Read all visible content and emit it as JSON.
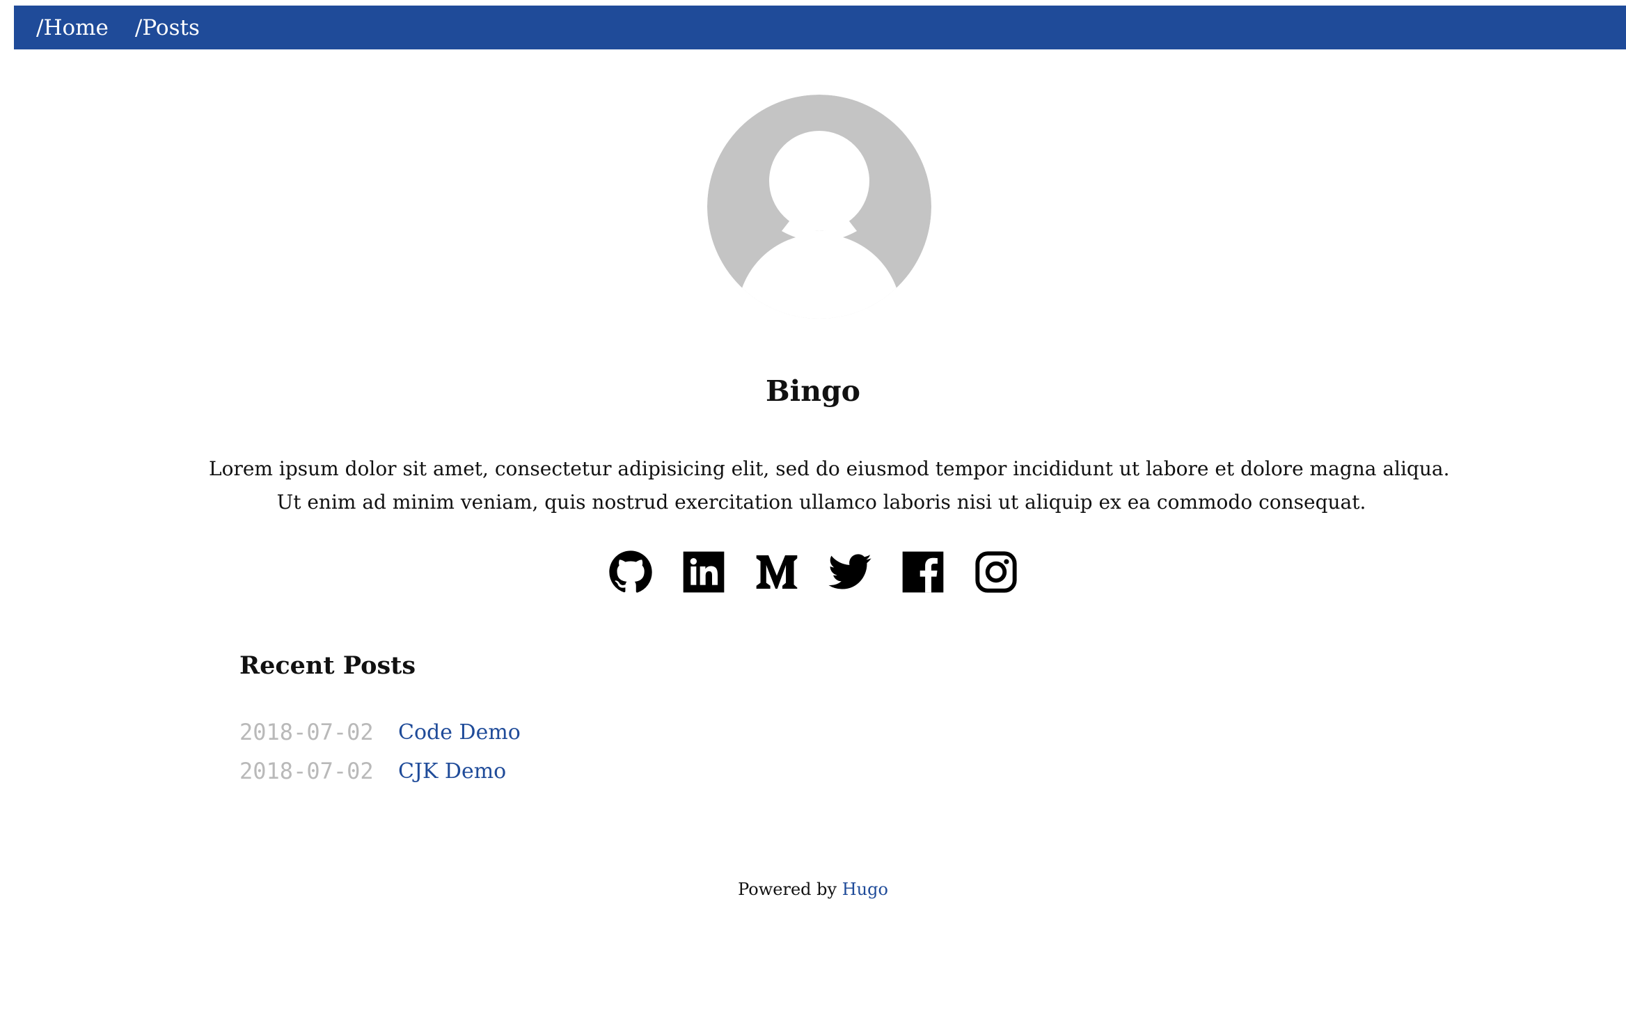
{
  "nav": {
    "links": [
      "/Home",
      "/Posts"
    ]
  },
  "profile": {
    "name": "Bingo",
    "bio_line1": "Lorem ipsum dolor sit amet, consectetur adipisicing elit, sed do eiusmod tempor incididunt ut labore et dolore magna aliqua.",
    "bio_line2": "Ut enim ad minim veniam, quis nostrud exercitation ullamco laboris nisi ut aliquip ex ea commodo consequat."
  },
  "social": {
    "icons": [
      "github-icon",
      "linkedin-icon",
      "medium-icon",
      "twitter-icon",
      "facebook-icon",
      "instagram-icon"
    ]
  },
  "recent_posts": {
    "title": "Recent Posts",
    "items": [
      {
        "date": "2018-07-02",
        "title": "Code Demo"
      },
      {
        "date": "2018-07-02",
        "title": "CJK Demo"
      }
    ]
  },
  "footer": {
    "text": "Powered by",
    "link": "Hugo"
  },
  "colors": {
    "navbar": "#1f4b99",
    "link": "#1f4b99",
    "date": "#b9b9b9",
    "avatar": "#c4c4c4"
  }
}
